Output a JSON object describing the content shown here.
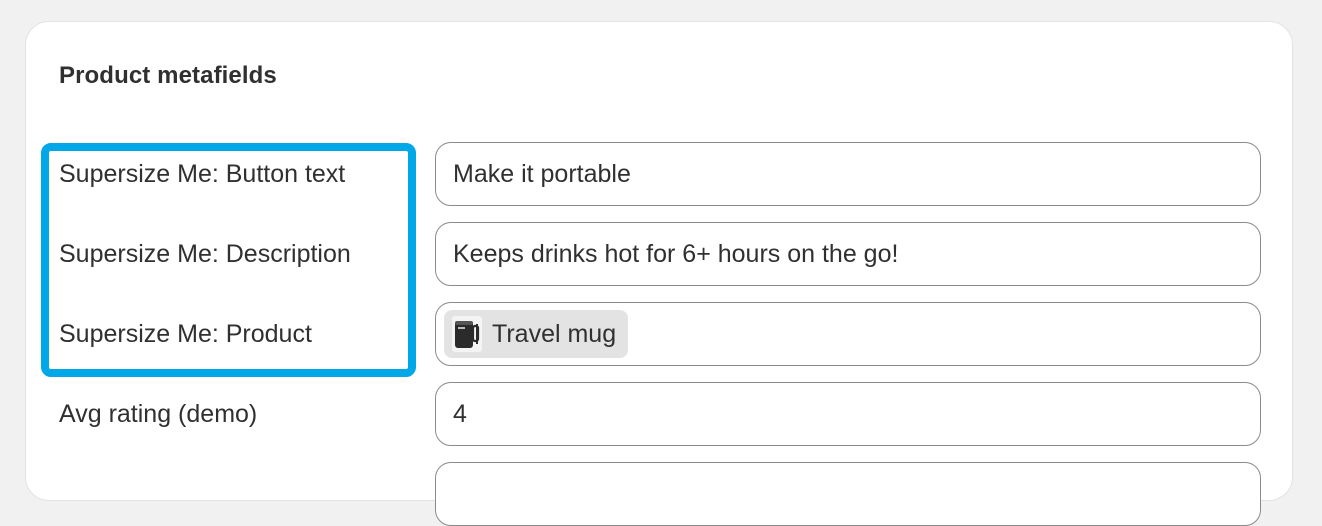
{
  "card": {
    "title": "Product metafields"
  },
  "fields": [
    {
      "label": "Supersize Me: Button text",
      "value": "Make it portable"
    },
    {
      "label": "Supersize Me: Description",
      "value": "Keeps drinks hot for 6+ hours on the go!"
    },
    {
      "label": "Supersize Me: Product",
      "reference": {
        "icon": "mug-thumbnail-icon",
        "label": "Travel mug"
      }
    },
    {
      "label": "Avg rating (demo)",
      "value": "4"
    },
    {
      "label": "",
      "value": ""
    }
  ],
  "colors": {
    "page_background": "#f1f1f1",
    "card_background": "#ffffff",
    "highlight": "#00a8e8",
    "input_border": "#8a8a8a",
    "chip_background": "#e3e3e3",
    "text": "#303030"
  }
}
